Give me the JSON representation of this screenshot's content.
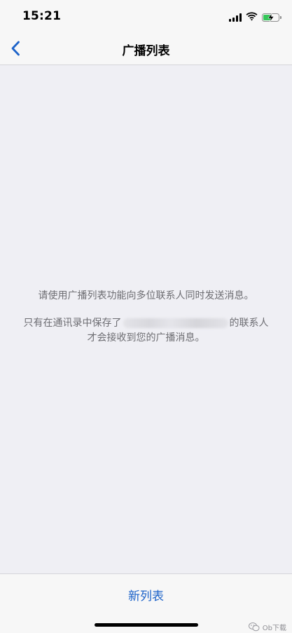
{
  "status_bar": {
    "time": "15:21",
    "icons": [
      "signal-icon",
      "wifi-icon",
      "battery-charging-icon"
    ],
    "battery_level": 0.6,
    "battery_color": "#34c759"
  },
  "nav": {
    "back_icon": "chevron-left-icon",
    "title": "广播列表"
  },
  "content": {
    "hint_primary": "请使用广播列表功能向多位联系人同时发送消息。",
    "hint_secondary_before": "只有在通讯录中保存了",
    "hint_secondary_after": "的联系人",
    "hint_secondary_line2": "才会接收到您的广播消息。"
  },
  "toolbar": {
    "new_list_label": "新列表"
  },
  "watermark": {
    "icon": "wechat-icon",
    "text": "Ob下载"
  },
  "colors": {
    "accent": "#1d63c9",
    "background": "#efeff4",
    "secondary_text": "#6d6d72"
  }
}
